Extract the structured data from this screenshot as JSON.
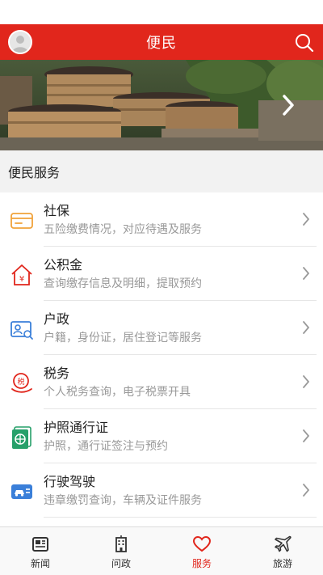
{
  "header": {
    "title": "便民"
  },
  "section": {
    "title": "便民服务"
  },
  "services": [
    {
      "name": "社保",
      "desc": "五险缴费情况，对应待遇及服务",
      "icon": "card-icon",
      "color": "#f0a23a"
    },
    {
      "name": "公积金",
      "desc": "查询缴存信息及明细，提取预约",
      "icon": "house-yuan-icon",
      "color": "#e1261c"
    },
    {
      "name": "户政",
      "desc": "户籍，身份证，居住登记等服务",
      "icon": "id-card-search-icon",
      "color": "#3a7fd9"
    },
    {
      "name": "税务",
      "desc": "个人税务查询，电子税票开具",
      "icon": "tax-hand-icon",
      "color": "#e1261c"
    },
    {
      "name": "护照通行证",
      "desc": "护照，通行证签注与预约",
      "icon": "passport-icon",
      "color": "#27a06a"
    },
    {
      "name": "行驶驾驶",
      "desc": "违章缴罚查询，车辆及证件服务",
      "icon": "vehicle-license-icon",
      "color": "#3a7fd9"
    }
  ],
  "tabs": [
    {
      "label": "新闻",
      "icon": "news-icon",
      "active": false
    },
    {
      "label": "问政",
      "icon": "building-icon",
      "active": false
    },
    {
      "label": "服务",
      "icon": "heart-icon",
      "active": true
    },
    {
      "label": "旅游",
      "icon": "airplane-icon",
      "active": false
    }
  ],
  "colors": {
    "brand": "#e1261c",
    "muted_text": "#999999"
  }
}
